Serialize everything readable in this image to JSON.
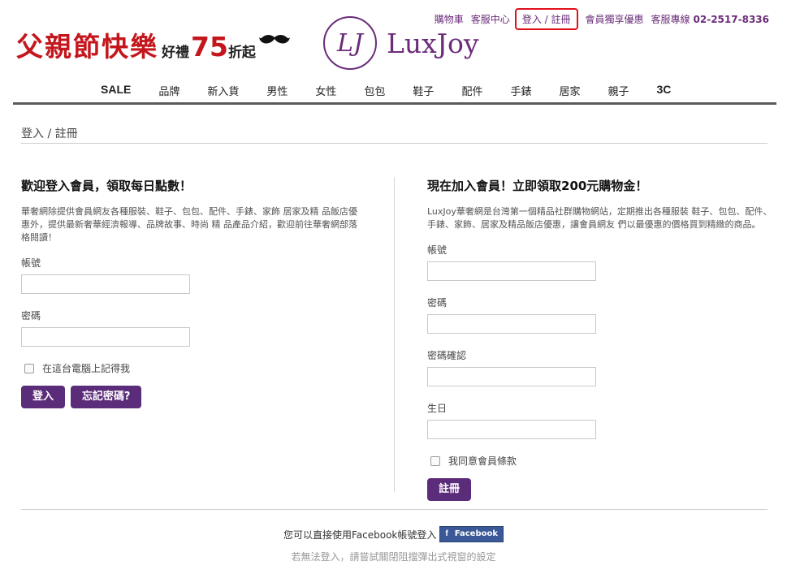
{
  "toplinks": {
    "cart": "購物車",
    "service": "客服中心",
    "login": "登入 / 註冊",
    "member_offers": "會員獨享優惠",
    "hotline_label": "客服專線",
    "hotline_number": "02-2517-8336"
  },
  "promo": {
    "headline": "父親節快樂",
    "gift": "好禮",
    "number": "75",
    "off": "折起"
  },
  "logo": {
    "monogram": "LJ",
    "name": "LuxJoy"
  },
  "nav": [
    "SALE",
    "品牌",
    "新入貨",
    "男性",
    "女性",
    "包包",
    "鞋子",
    "配件",
    "手錶",
    "居家",
    "親子",
    "3C"
  ],
  "page_title": "登入 / 註冊",
  "login_section": {
    "heading": "歡迎登入會員，領取每日點數！",
    "description": "華奢網除提供會員網友各種服裝、鞋子、包包、配件、手錶、家飾 居家及精 品飯店優惠外，提供最新奢華經濟報導、品牌故事、時尚 精 品產品介紹，歡迎前往華奢網部落格閱讀！",
    "account_label": "帳號",
    "password_label": "密碼",
    "remember_label": "在這台電腦上記得我",
    "login_button": "登入",
    "forgot_button": "忘記密碼?"
  },
  "register_section": {
    "heading": "現在加入會員！立即領取200元購物金！",
    "description": "LuxJoy華奢網是台灣第一個精品社群購物網站，定期推出各種服裝 鞋子、包包、配件、手錶、家飾、居家及精品飯店優惠，讓會員網友 們以最優惠的價格買到精緻的商品。",
    "account_label": "帳號",
    "password_label": "密碼",
    "confirm_label": "密碼確認",
    "birthday_label": "生日",
    "agree_label": "我同意會員條款",
    "register_button": "註冊"
  },
  "facebook": {
    "prompt": "您可以直接使用Facebook帳號登入",
    "button_label": "Facebook",
    "note": "若無法登入，請嘗試關閉阻擋彈出式視窗的設定"
  },
  "colors": {
    "brand_purple": "#5b2c79",
    "promo_red": "#c4161c",
    "highlight_red": "#e0111b",
    "facebook_blue": "#3b5998"
  }
}
